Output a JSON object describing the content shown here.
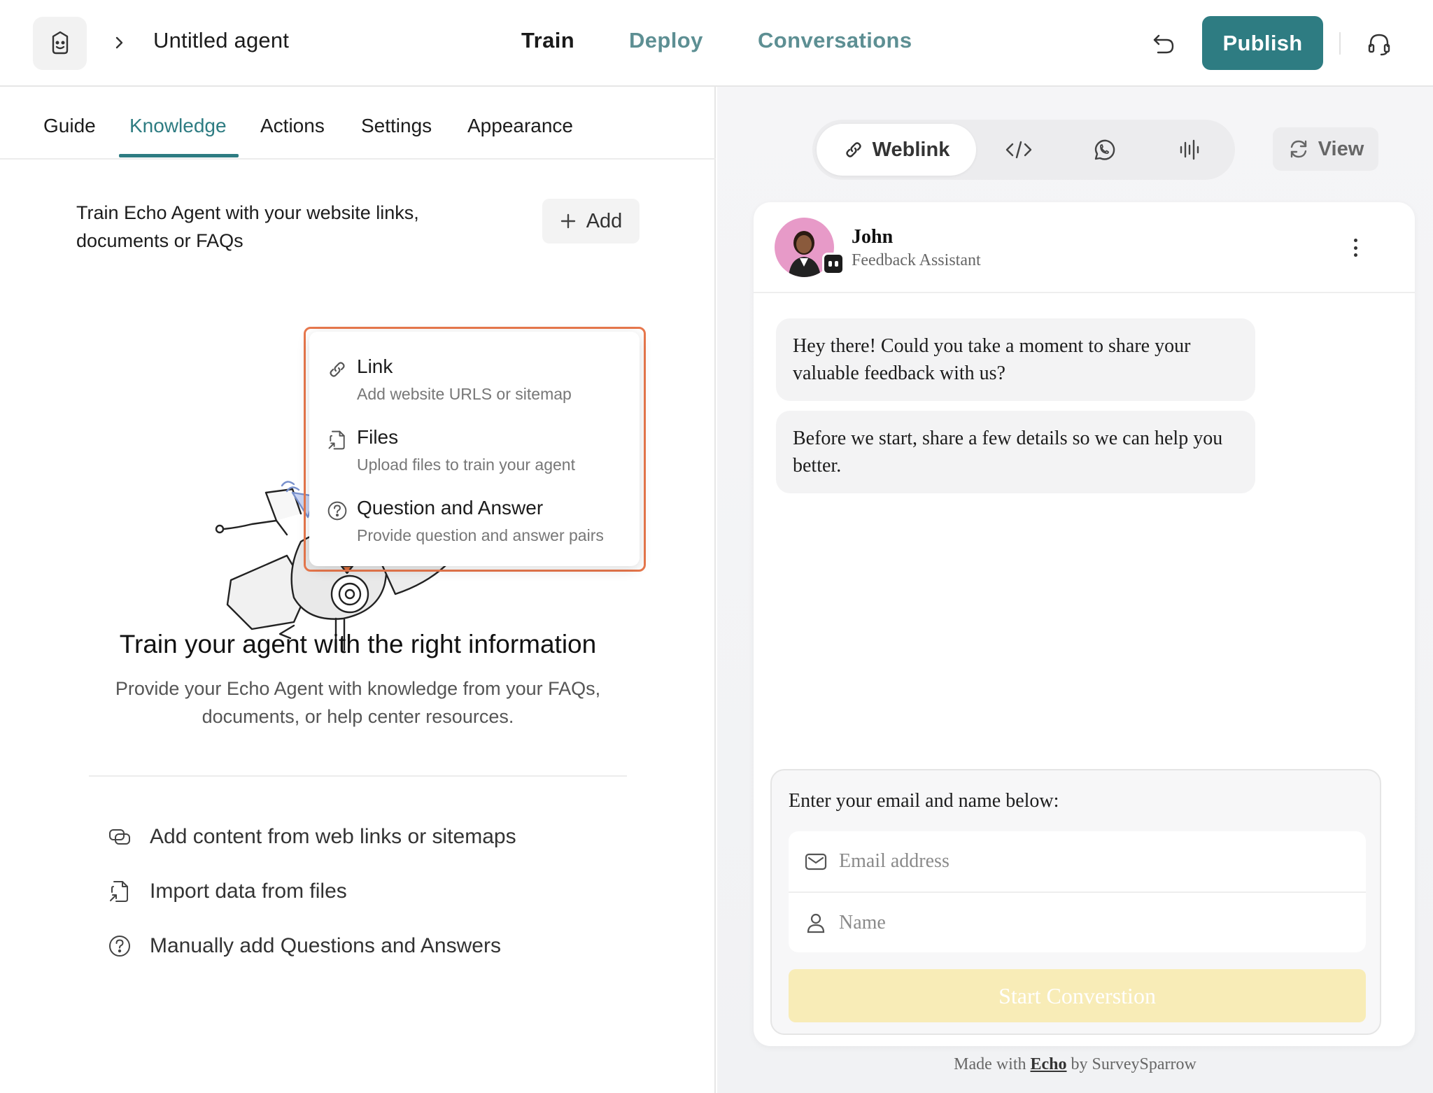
{
  "header": {
    "breadcrumb_title": "Untitled agent",
    "nav_tabs": [
      {
        "label": "Train",
        "active": true
      },
      {
        "label": "Deploy",
        "active": false
      },
      {
        "label": "Conversations",
        "active": false
      }
    ],
    "publish_label": "Publish"
  },
  "left_panel": {
    "sub_tabs": [
      {
        "label": "Guide",
        "active": false
      },
      {
        "label": "Knowledge",
        "active": true
      },
      {
        "label": "Actions",
        "active": false
      },
      {
        "label": "Settings",
        "active": false
      },
      {
        "label": "Appearance",
        "active": false
      }
    ],
    "intro_text": "Train Echo Agent with your website links, documents or FAQs",
    "add_label": "Add",
    "dropdown": [
      {
        "icon": "link-icon",
        "title": "Link",
        "subtitle": "Add website URLS or sitemap"
      },
      {
        "icon": "file-import-icon",
        "title": "Files",
        "subtitle": "Upload files to train your agent"
      },
      {
        "icon": "question-circle-icon",
        "title": "Question and Answer",
        "subtitle": "Provide question and answer pairs"
      }
    ],
    "empty_state": {
      "title": "Train your agent with the right information",
      "description": "Provide your Echo Agent with knowledge from your FAQs, documents, or help center resources."
    },
    "features": [
      {
        "icon": "web-links-icon",
        "label": "Add content from web links or sitemaps"
      },
      {
        "icon": "file-import-icon",
        "label": "Import data from files"
      },
      {
        "icon": "question-circle-icon",
        "label": "Manually add Questions and Answers"
      }
    ]
  },
  "preview": {
    "channels": [
      {
        "icon": "link-icon",
        "label": "Weblink",
        "active": true
      },
      {
        "icon": "code-icon",
        "active": false
      },
      {
        "icon": "whatsapp-icon",
        "active": false
      },
      {
        "icon": "voice-wave-icon",
        "active": false
      }
    ],
    "view_label": "View",
    "agent": {
      "name": "John",
      "role": "Feedback Assistant"
    },
    "messages": [
      "Hey there! Could you take a moment to share your valuable feedback with us?",
      "Before we start, share a few details so we can help you better."
    ],
    "form": {
      "label": "Enter your email and name below:",
      "email_placeholder": "Email address",
      "name_placeholder": "Name",
      "submit_label": "Start Converstion"
    },
    "footer": {
      "prefix": "Made with",
      "brand": "Echo",
      "suffix": "by SurveySparrow"
    }
  },
  "colors": {
    "accent": "#2e7c82",
    "nav_inactive": "#5d8f93",
    "highlight_outline": "#e8784d",
    "submit_disabled": "#f8ecb7",
    "avatar_bg": "#e79ac8"
  }
}
